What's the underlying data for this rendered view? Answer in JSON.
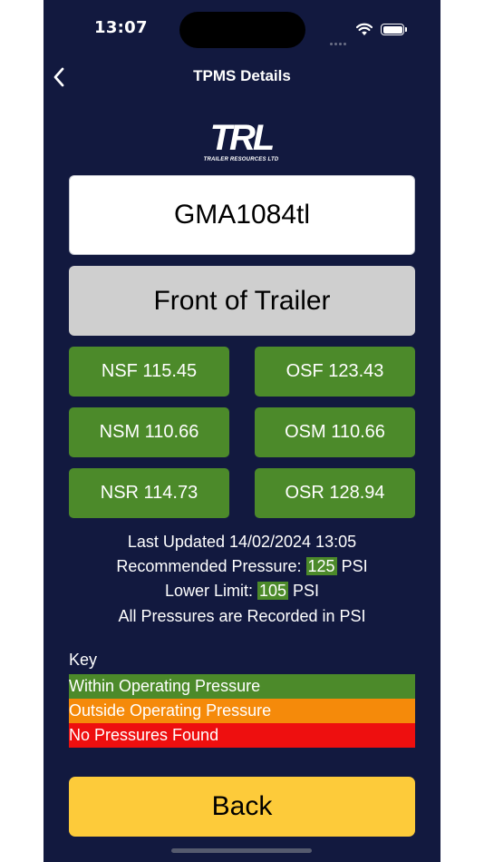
{
  "status_bar": {
    "time": "13:07"
  },
  "nav": {
    "title": "TPMS Details"
  },
  "logo": {
    "main": "TRL",
    "subtitle": "TRAILER RESOURCES LTD"
  },
  "trailer": {
    "id": "GMA1084tl",
    "position": "Front of Trailer"
  },
  "tyres": [
    {
      "label": "NSF 115.45",
      "status": "within"
    },
    {
      "label": "OSF 123.43",
      "status": "within"
    },
    {
      "label": "NSM 110.66",
      "status": "within"
    },
    {
      "label": "OSM 110.66",
      "status": "within"
    },
    {
      "label": "NSR 114.73",
      "status": "within"
    },
    {
      "label": "OSR 128.94",
      "status": "within"
    }
  ],
  "info": {
    "last_updated": "Last Updated 14/02/2024 13:05",
    "recommended_prefix": "Recommended Pressure:",
    "recommended_value": "125",
    "recommended_unit": "PSI",
    "lower_prefix": "Lower Limit:",
    "lower_value": "105",
    "lower_unit": "PSI",
    "note": "All Pressures are Recorded in PSI"
  },
  "key": {
    "label": "Key",
    "items": [
      {
        "label": "Within Operating Pressure",
        "color": "#4c8a2a"
      },
      {
        "label": "Outside Operating Pressure",
        "color": "#f58a0a"
      },
      {
        "label": "No Pressures Found",
        "color": "#ee0f0f"
      }
    ]
  },
  "back_button": {
    "label": "Back"
  },
  "colors": {
    "background": "#12193f",
    "within": "#4c8a2a",
    "outside": "#f58a0a",
    "none": "#ee0f0f",
    "button": "#fdcb3a"
  }
}
